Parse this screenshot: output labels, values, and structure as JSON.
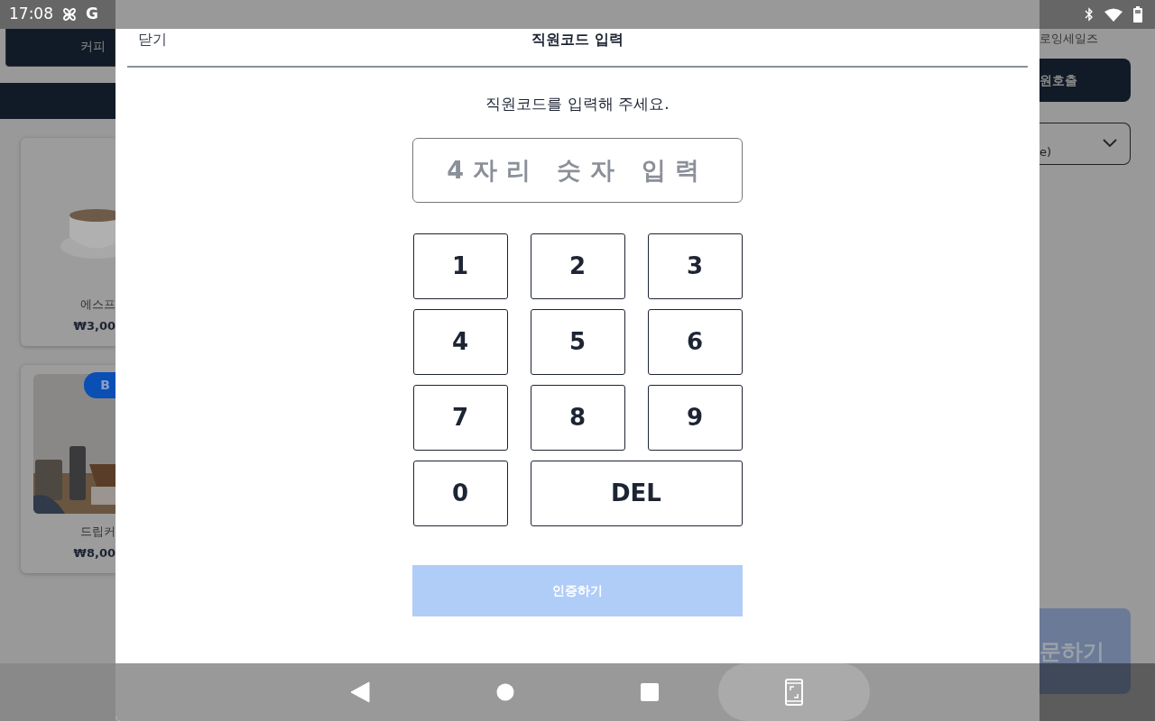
{
  "status_bar": {
    "time": "17:08",
    "app_letter": "G"
  },
  "background": {
    "category_tab": "커피",
    "store_name": "로잉세일즈",
    "call_button": "원호출",
    "select_value": "e)",
    "order_button": "문하기",
    "products": [
      {
        "name": "에스프",
        "price": "₩3,00"
      },
      {
        "name": "드립커",
        "price": "₩8,00",
        "badge": "B"
      }
    ]
  },
  "dialog": {
    "close": "닫기",
    "title": "직원코드 입력",
    "prompt": "직원코드를 입력해 주세요.",
    "code_field": {
      "placeholder": "4자리 숫자 입력"
    },
    "keys": [
      {
        "label": "1",
        "kind": "digit"
      },
      {
        "label": "2",
        "kind": "digit"
      },
      {
        "label": "3",
        "kind": "digit"
      },
      {
        "label": "4",
        "kind": "digit"
      },
      {
        "label": "5",
        "kind": "digit"
      },
      {
        "label": "6",
        "kind": "digit"
      },
      {
        "label": "7",
        "kind": "digit"
      },
      {
        "label": "8",
        "kind": "digit"
      },
      {
        "label": "9",
        "kind": "digit"
      },
      {
        "label": "0",
        "kind": "digit"
      },
      {
        "label": "DEL",
        "kind": "delete"
      }
    ],
    "confirm": {
      "label": "인증하기",
      "disabled": true
    }
  }
}
